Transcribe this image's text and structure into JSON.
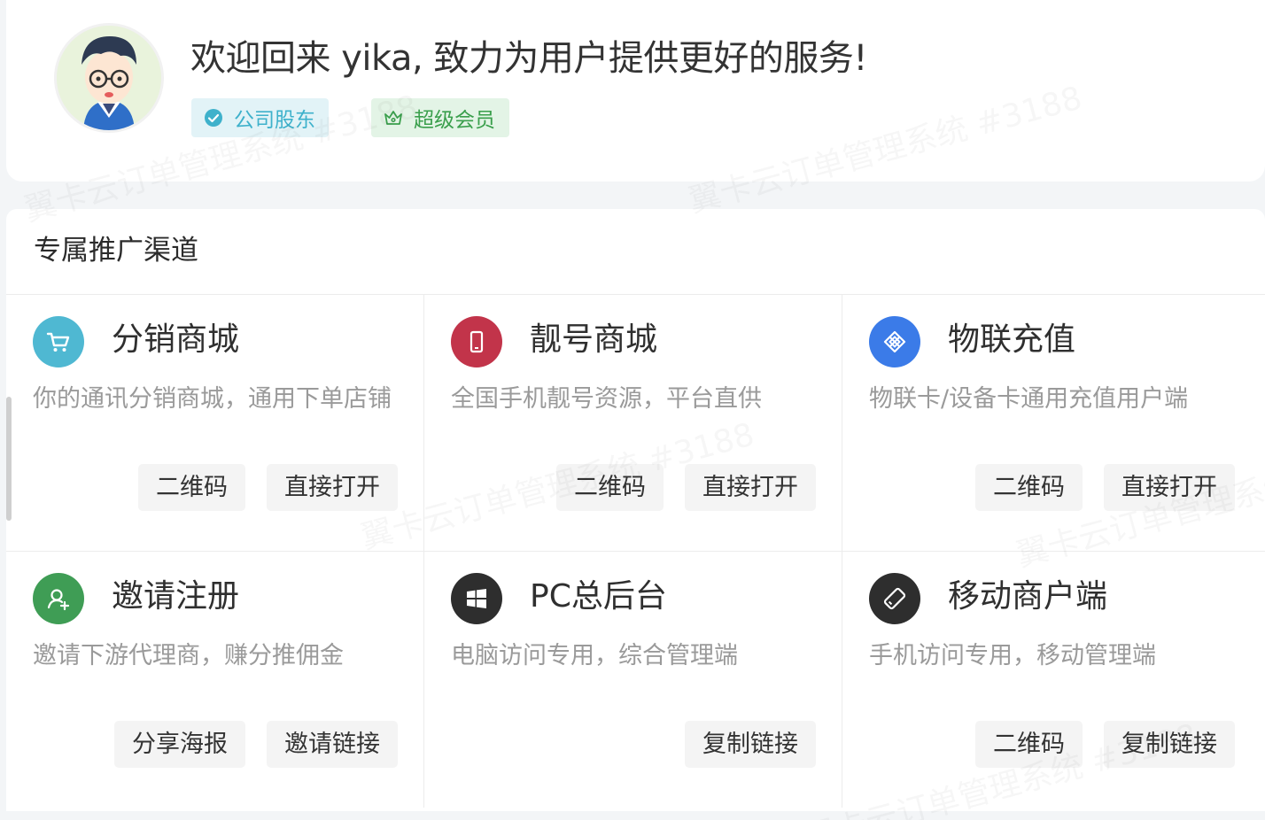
{
  "header": {
    "welcome_text": "欢迎回来 yika, 致力为用户提供更好的服务!",
    "badges": [
      {
        "label": "公司股东",
        "icon": "check-circle-icon",
        "color": "#3eb1cb"
      },
      {
        "label": "超级会员",
        "icon": "crown-icon",
        "color": "#3a9f4c"
      }
    ]
  },
  "channels": {
    "title": "专属推广渠道",
    "items": [
      {
        "title": "分销商城",
        "desc": "你的通讯分销商城，通用下单店铺",
        "icon": "cart-icon",
        "color": "#4fb8d2",
        "actions": [
          "二维码",
          "直接打开"
        ]
      },
      {
        "title": "靓号商城",
        "desc": "全国手机靓号资源，平台直供",
        "icon": "mobile-icon",
        "color": "#c2344a",
        "actions": [
          "二维码",
          "直接打开"
        ]
      },
      {
        "title": "物联充值",
        "desc": "物联卡/设备卡通用充值用户端",
        "icon": "cube-icon",
        "color": "#3b7be8",
        "actions": [
          "二维码",
          "直接打开"
        ]
      },
      {
        "title": "邀请注册",
        "desc": "邀请下游代理商，赚分推佣金",
        "icon": "user-add-icon",
        "color": "#3f9d55",
        "actions": [
          "分享海报",
          "邀请链接"
        ]
      },
      {
        "title": "PC总后台",
        "desc": "电脑访问专用，综合管理端",
        "icon": "windows-icon",
        "color": "#2e2e2e",
        "actions": [
          "复制链接"
        ]
      },
      {
        "title": "移动商户端",
        "desc": "手机访问专用，移动管理端",
        "icon": "mobile-tilted-icon",
        "color": "#2e2e2e",
        "actions": [
          "二维码",
          "复制链接"
        ]
      }
    ]
  },
  "watermark_text": "翼卡云订单管理系统 #3188"
}
